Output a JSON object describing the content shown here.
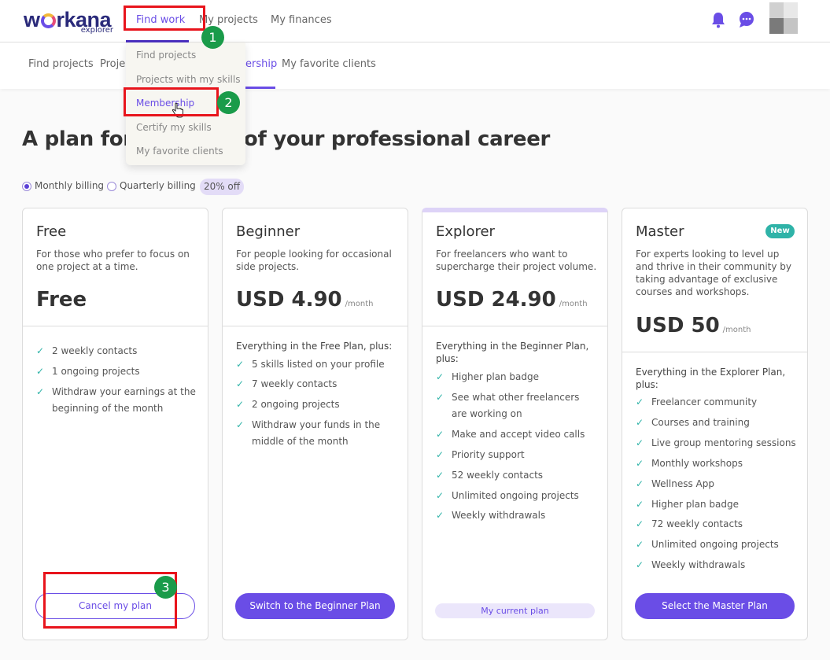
{
  "brand": {
    "name": "workana",
    "word_pre": "w",
    "word_post": "rkana",
    "tier": "explorer"
  },
  "top_nav": {
    "items": [
      {
        "label": "Find work",
        "active": true
      },
      {
        "label": "My projects"
      },
      {
        "label": "My finances"
      }
    ]
  },
  "header_icons": [
    "bell-icon",
    "chat-icon"
  ],
  "sub_nav": {
    "items": [
      {
        "label": "Find projects"
      },
      {
        "label": "Projec"
      },
      {
        "label": "ership",
        "active": true
      },
      {
        "label": "My favorite clients"
      }
    ]
  },
  "dropdown": {
    "items": [
      {
        "label": "Find projects"
      },
      {
        "label": "Projects with my skills"
      },
      {
        "label": "Membership",
        "selected": true
      },
      {
        "label": "Certify my skills"
      },
      {
        "label": "My favorite clients"
      }
    ]
  },
  "headline": {
    "part1": "A plan for",
    "part2": "e of your professional career"
  },
  "billing": {
    "monthly": "Monthly billing",
    "quarterly": "Quarterly billing",
    "discount": "20% off",
    "selected": "monthly"
  },
  "plans": [
    {
      "name": "Free",
      "description": "For those who prefer to focus on one project at a time.",
      "price": "Free",
      "period": "",
      "features_heading": "",
      "features": [
        "2 weekly contacts",
        "1 ongoing projects",
        "Withdraw your earnings at the beginning of the month"
      ],
      "button": "Cancel my plan"
    },
    {
      "name": "Beginner",
      "description": "For people looking for occasional side projects.",
      "price": "USD 4.90",
      "period": "/month",
      "features_heading": "Everything in the Free Plan, plus:",
      "features": [
        "5 skills listed on your profile",
        "7 weekly contacts",
        "2 ongoing projects",
        "Withdraw your funds in the middle of the month"
      ],
      "button": "Switch to the Beginner Plan"
    },
    {
      "name": "Explorer",
      "description": "For freelancers who want to supercharge their project volume.",
      "price": "USD 24.90",
      "period": "/month",
      "features_heading": "Everything in the Beginner Plan, plus:",
      "features": [
        "Higher plan badge",
        "See what other freelancers are working on",
        "Make and accept video calls",
        "Priority support",
        "52 weekly contacts",
        "Unlimited ongoing projects",
        "Weekly withdrawals"
      ],
      "button": "My current plan"
    },
    {
      "name": "Master",
      "badge": "New",
      "description": "For experts looking to level up and thrive in their community by taking advantage of exclusive courses and workshops.",
      "price": "USD 50",
      "period": "/month",
      "features_heading": "Everything in the Explorer Plan, plus:",
      "features": [
        "Freelancer community",
        "Courses and training",
        "Live group mentoring sessions",
        "Monthly workshops",
        "Wellness App",
        "Higher plan badge",
        "72 weekly contacts",
        "Unlimited ongoing projects",
        "Weekly withdrawals"
      ],
      "button": "Select the Master Plan"
    }
  ],
  "annotations": [
    "1",
    "2",
    "3"
  ],
  "colors": {
    "brand": "#6a4de6",
    "check": "#2fb3a8",
    "annotation_box": "#e8141c",
    "annotation_badge": "#1a9b4a"
  }
}
